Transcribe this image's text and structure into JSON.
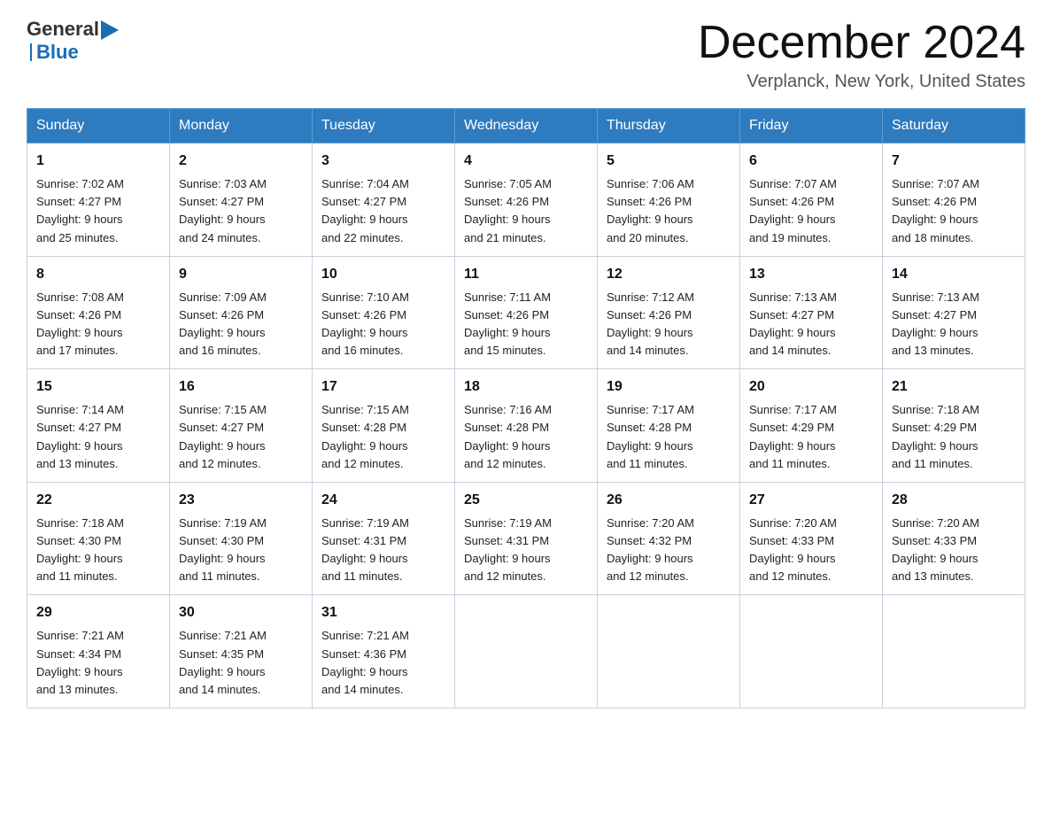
{
  "header": {
    "logo_general": "General",
    "logo_blue": "Blue",
    "month_title": "December 2024",
    "location": "Verplanck, New York, United States"
  },
  "days_of_week": [
    "Sunday",
    "Monday",
    "Tuesday",
    "Wednesday",
    "Thursday",
    "Friday",
    "Saturday"
  ],
  "weeks": [
    [
      {
        "day": "1",
        "sunrise": "7:02 AM",
        "sunset": "4:27 PM",
        "daylight": "9 hours and 25 minutes."
      },
      {
        "day": "2",
        "sunrise": "7:03 AM",
        "sunset": "4:27 PM",
        "daylight": "9 hours and 24 minutes."
      },
      {
        "day": "3",
        "sunrise": "7:04 AM",
        "sunset": "4:27 PM",
        "daylight": "9 hours and 22 minutes."
      },
      {
        "day": "4",
        "sunrise": "7:05 AM",
        "sunset": "4:26 PM",
        "daylight": "9 hours and 21 minutes."
      },
      {
        "day": "5",
        "sunrise": "7:06 AM",
        "sunset": "4:26 PM",
        "daylight": "9 hours and 20 minutes."
      },
      {
        "day": "6",
        "sunrise": "7:07 AM",
        "sunset": "4:26 PM",
        "daylight": "9 hours and 19 minutes."
      },
      {
        "day": "7",
        "sunrise": "7:07 AM",
        "sunset": "4:26 PM",
        "daylight": "9 hours and 18 minutes."
      }
    ],
    [
      {
        "day": "8",
        "sunrise": "7:08 AM",
        "sunset": "4:26 PM",
        "daylight": "9 hours and 17 minutes."
      },
      {
        "day": "9",
        "sunrise": "7:09 AM",
        "sunset": "4:26 PM",
        "daylight": "9 hours and 16 minutes."
      },
      {
        "day": "10",
        "sunrise": "7:10 AM",
        "sunset": "4:26 PM",
        "daylight": "9 hours and 16 minutes."
      },
      {
        "day": "11",
        "sunrise": "7:11 AM",
        "sunset": "4:26 PM",
        "daylight": "9 hours and 15 minutes."
      },
      {
        "day": "12",
        "sunrise": "7:12 AM",
        "sunset": "4:26 PM",
        "daylight": "9 hours and 14 minutes."
      },
      {
        "day": "13",
        "sunrise": "7:13 AM",
        "sunset": "4:27 PM",
        "daylight": "9 hours and 14 minutes."
      },
      {
        "day": "14",
        "sunrise": "7:13 AM",
        "sunset": "4:27 PM",
        "daylight": "9 hours and 13 minutes."
      }
    ],
    [
      {
        "day": "15",
        "sunrise": "7:14 AM",
        "sunset": "4:27 PM",
        "daylight": "9 hours and 13 minutes."
      },
      {
        "day": "16",
        "sunrise": "7:15 AM",
        "sunset": "4:27 PM",
        "daylight": "9 hours and 12 minutes."
      },
      {
        "day": "17",
        "sunrise": "7:15 AM",
        "sunset": "4:28 PM",
        "daylight": "9 hours and 12 minutes."
      },
      {
        "day": "18",
        "sunrise": "7:16 AM",
        "sunset": "4:28 PM",
        "daylight": "9 hours and 12 minutes."
      },
      {
        "day": "19",
        "sunrise": "7:17 AM",
        "sunset": "4:28 PM",
        "daylight": "9 hours and 11 minutes."
      },
      {
        "day": "20",
        "sunrise": "7:17 AM",
        "sunset": "4:29 PM",
        "daylight": "9 hours and 11 minutes."
      },
      {
        "day": "21",
        "sunrise": "7:18 AM",
        "sunset": "4:29 PM",
        "daylight": "9 hours and 11 minutes."
      }
    ],
    [
      {
        "day": "22",
        "sunrise": "7:18 AM",
        "sunset": "4:30 PM",
        "daylight": "9 hours and 11 minutes."
      },
      {
        "day": "23",
        "sunrise": "7:19 AM",
        "sunset": "4:30 PM",
        "daylight": "9 hours and 11 minutes."
      },
      {
        "day": "24",
        "sunrise": "7:19 AM",
        "sunset": "4:31 PM",
        "daylight": "9 hours and 11 minutes."
      },
      {
        "day": "25",
        "sunrise": "7:19 AM",
        "sunset": "4:31 PM",
        "daylight": "9 hours and 12 minutes."
      },
      {
        "day": "26",
        "sunrise": "7:20 AM",
        "sunset": "4:32 PM",
        "daylight": "9 hours and 12 minutes."
      },
      {
        "day": "27",
        "sunrise": "7:20 AM",
        "sunset": "4:33 PM",
        "daylight": "9 hours and 12 minutes."
      },
      {
        "day": "28",
        "sunrise": "7:20 AM",
        "sunset": "4:33 PM",
        "daylight": "9 hours and 13 minutes."
      }
    ],
    [
      {
        "day": "29",
        "sunrise": "7:21 AM",
        "sunset": "4:34 PM",
        "daylight": "9 hours and 13 minutes."
      },
      {
        "day": "30",
        "sunrise": "7:21 AM",
        "sunset": "4:35 PM",
        "daylight": "9 hours and 14 minutes."
      },
      {
        "day": "31",
        "sunrise": "7:21 AM",
        "sunset": "4:36 PM",
        "daylight": "9 hours and 14 minutes."
      },
      null,
      null,
      null,
      null
    ]
  ],
  "labels": {
    "sunrise": "Sunrise:",
    "sunset": "Sunset:",
    "daylight": "Daylight:"
  }
}
